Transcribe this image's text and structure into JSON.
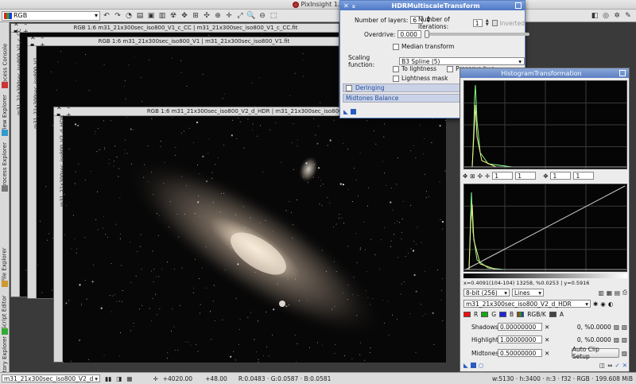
{
  "app": {
    "title": "PixInsight 1.8"
  },
  "toolbar": {
    "color_space": "RGB"
  },
  "sidebar": {
    "tabs": [
      "Process Console",
      "View Explorer",
      "Process Explorer",
      "File Explorer",
      "Script Editor",
      "History Explorer"
    ]
  },
  "windows": {
    "w1": {
      "title": "RGB 1:6 m31_21x300sec_iso800_V1_c_CC | m31_21x300sec_iso800_V1_c_CC.fit",
      "side": "m31_21x300sec_iso800_V1_c_CC"
    },
    "w2": {
      "title": "RGB 1:6 m31_21x300sec_iso800_V1 | m31_21x300sec_iso800_V1.fit",
      "side": "m31_21x300sec_iso800_V1"
    },
    "w3": {
      "title": "RGB 1:6 m31_21x300sec_iso800_V2_d_HDR | m31_21x300sec_iso800_V2_d_HDR",
      "side": "m31_21x300sec_iso800_V2_d_HDR"
    }
  },
  "hdr": {
    "title": "HDRMultiscaleTransform",
    "layers_label": "Number of layers:",
    "layers": "6",
    "iter_label": "Number of iterations:",
    "iter": "1",
    "inverted": "Inverted",
    "overdrive_label": "Overdrive:",
    "overdrive": "0.000",
    "median": "Median transform",
    "scaling_label": "Scaling function:",
    "scaling": "B3 Spline (5)",
    "to_lightness": "To lightness",
    "preserve_hue": "Preserve hue",
    "lightness_mask": "Lightness mask",
    "deringing": "Deringing",
    "midtones": "Midtones Balance"
  },
  "hist": {
    "title": "HistogramTransformation",
    "zoom1": "1",
    "zoom2": "1",
    "zoom3": "1",
    "zoom4": "1",
    "readout": "x=0.4091(104-104) 13258, %0.0253 | y=0.5916",
    "bits": "8-bit (256)",
    "mode": "Lines",
    "view": "m31_21x300sec_iso800_V2_d_HDR",
    "ch_r": "R",
    "ch_g": "G",
    "ch_b": "B",
    "ch_rgbk": "RGB/K",
    "ch_a": "A",
    "shadows_label": "Shadows:",
    "shadows": "0.00000000",
    "shadows_pct": "0, %0.0000",
    "highlights_label": "Highlights:",
    "highlights": "1.00000000",
    "highlights_pct": "0, %0.0000",
    "midtones_label": "Midtones:",
    "midtones": "0.50000000",
    "auto_clip": "Auto Clip Setup",
    "colors": {
      "red": "#e11",
      "green": "#1a1",
      "blue": "#22d"
    }
  },
  "status": {
    "view": "m31_21x300sec_iso800_V2_d",
    "coord1": "+4020.00",
    "coord2": "+48.00",
    "rgb": "R:0.0483 · G:0.0587 · B:0.0581",
    "info": "w:5130 · h:3400 · n:3 · f32 · RGB · 199.608 MiB"
  }
}
